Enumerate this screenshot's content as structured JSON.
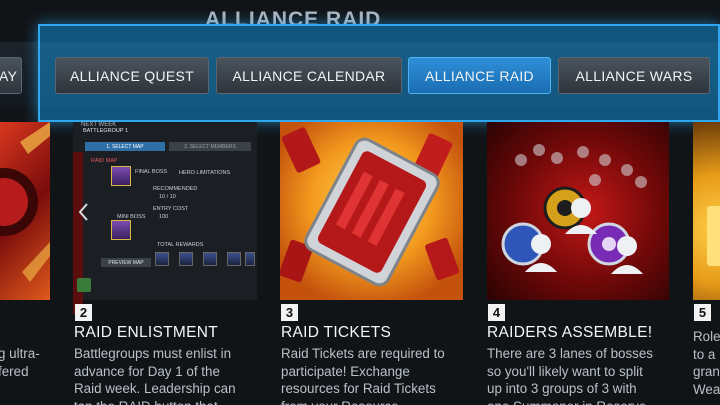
{
  "page": {
    "title": "ALLIANCE RAID"
  },
  "tabs": [
    {
      "label": "AY"
    },
    {
      "label": "ALLIANCE QUEST"
    },
    {
      "label": "ALLIANCE CALENDAR"
    },
    {
      "label": "ALLIANCE RAID"
    },
    {
      "label": "ALLIANCE WARS"
    }
  ],
  "cards": [
    {
      "title": "",
      "body": "g ultra-\nfered"
    },
    {
      "number": "2",
      "title": "RAID ENLISTMENT",
      "body": "Battlegroups must enlist in\nadvance for Day 1 of the\nRaid week. Leadership can\ntap the RAID button that",
      "map": {
        "next_week": "NEXT WEEK",
        "battlegroup": "BATTLEGROUP 1",
        "select_map": "1. SELECT MAP",
        "select_members": "2. SELECT MEMBERS",
        "raid_map": "RAID MAP",
        "final_boss": "FINAL BOSS",
        "hero_limitations": "HERO LIMITATIONS",
        "recommended": "RECOMMENDED",
        "recommended_value": "10 / 10",
        "entry_cost": "ENTRY COST",
        "entry_cost_value": "100",
        "mini_boss": "MINI BOSS",
        "total_rewards": "TOTAL REWARDS",
        "preview_map": "PREVIEW MAP"
      }
    },
    {
      "number": "3",
      "title": "RAID TICKETS",
      "body": "Raid Tickets are required to\nparticipate! Exchange\nresources for Raid Tickets\nfrom your Resource"
    },
    {
      "number": "4",
      "title": "RAIDERS ASSEMBLE!",
      "body": "There are 3 lanes of bosses\nso you'll likely want to split\nup into 3 groups of 3 with\none Summoner in Reserve"
    },
    {
      "number": "5",
      "title": "",
      "body": "Role\nto a\ngran\nWea"
    }
  ],
  "colors": {
    "accent_blue": "#2fa8f0",
    "active_tab": "#1a6db2",
    "background": "#111417"
  }
}
